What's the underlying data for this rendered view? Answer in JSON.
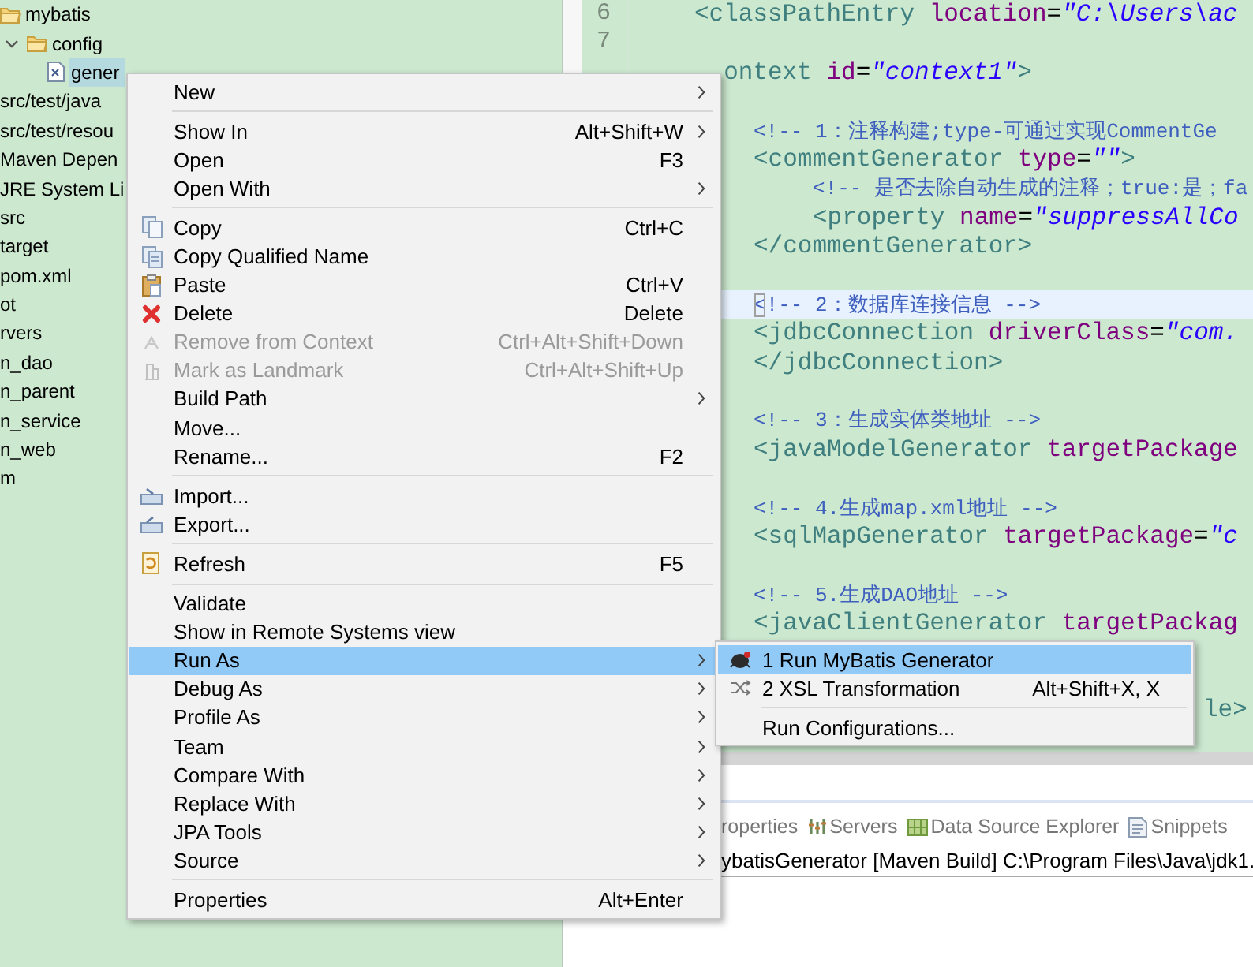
{
  "explorer": {
    "items": [
      {
        "label": "mybatis",
        "selected": false,
        "children": [
          {
            "label": "config",
            "selected": false,
            "expanded": true,
            "children": [
              {
                "label": "gener",
                "selected": true
              }
            ]
          }
        ]
      },
      {
        "label": "src/test/java",
        "selected": false
      },
      {
        "label": "src/test/resou",
        "selected": false
      },
      {
        "label": "Maven Depen",
        "selected": false
      },
      {
        "label": "JRE System Li",
        "selected": false
      },
      {
        "label": "src",
        "selected": false
      },
      {
        "label": "target",
        "selected": false
      },
      {
        "label": "pom.xml",
        "selected": false
      },
      {
        "label": "ot",
        "selected": false
      },
      {
        "label": "rvers",
        "selected": false
      },
      {
        "label": "n_dao",
        "selected": false
      },
      {
        "label": "n_parent",
        "selected": false
      },
      {
        "label": "n_service",
        "selected": false
      },
      {
        "label": "n_web",
        "selected": false
      },
      {
        "label": "m",
        "selected": false
      }
    ]
  },
  "editor": {
    "line_numbers": [
      "6",
      "7"
    ],
    "lines": [
      {
        "kind": "code",
        "segments": [
          {
            "kind": "tag",
            "text": "<classPathEntry"
          },
          {
            "kind": "attr",
            "text": "location"
          },
          {
            "kind": "plain",
            "text": "="
          },
          {
            "kind": "value",
            "text": "\"C:\\Users\\ac"
          }
        ]
      },
      {
        "kind": "blank"
      },
      {
        "kind": "clipped",
        "segments": [
          {
            "kind": "tag",
            "text": "ontext"
          },
          {
            "kind": "attr",
            "text": "id"
          },
          {
            "kind": "plain",
            "text": "="
          },
          {
            "kind": "value",
            "text": "\"context1\""
          },
          {
            "kind": "tag",
            "text": ">"
          }
        ],
        "children": [
          {
            "kind": "blank"
          },
          {
            "kind": "code",
            "segments": [
              {
                "kind": "comment",
                "text": "<!-- 1：注释构建;type-可通过实现CommentGe"
              }
            ]
          },
          {
            "kind": "code",
            "segments": [
              {
                "kind": "tag",
                "text": "<commentGenerator"
              },
              {
                "kind": "attr",
                "text": "type"
              },
              {
                "kind": "plain",
                "text": "="
              },
              {
                "kind": "value",
                "text": "\"\""
              },
              {
                "kind": "tag",
                "text": ">"
              }
            ],
            "children": [
              {
                "kind": "code",
                "segments": [
                  {
                    "kind": "comment",
                    "text": "<!-- 是否去除自动生成的注释；true:是；fa"
                  }
                ]
              },
              {
                "kind": "code",
                "segments": [
                  {
                    "kind": "tag",
                    "text": "<property"
                  },
                  {
                    "kind": "attr",
                    "text": "name"
                  },
                  {
                    "kind": "plain",
                    "text": "="
                  },
                  {
                    "kind": "value",
                    "text": "\"suppressAllCo"
                  }
                ]
              }
            ]
          },
          {
            "kind": "code",
            "segments": [
              {
                "kind": "tag",
                "text": "</commentGenerator>"
              }
            ]
          },
          {
            "kind": "blank"
          },
          {
            "kind": "code",
            "current": true,
            "segments": [
              {
                "kind": "comment",
                "text": "<!-- 2：数据库连接信息 -->"
              }
            ]
          },
          {
            "kind": "code",
            "segments": [
              {
                "kind": "tag",
                "text": "<jdbcConnection"
              },
              {
                "kind": "attr",
                "text": "driverClass"
              },
              {
                "kind": "plain",
                "text": "="
              },
              {
                "kind": "value",
                "text": "\"com."
              }
            ]
          },
          {
            "kind": "code",
            "segments": [
              {
                "kind": "tag",
                "text": "</jdbcConnection>"
              }
            ]
          },
          {
            "kind": "blank"
          },
          {
            "kind": "code",
            "segments": [
              {
                "kind": "comment",
                "text": "<!-- 3：生成实体类地址 -->"
              }
            ]
          },
          {
            "kind": "code",
            "segments": [
              {
                "kind": "tag",
                "text": "<javaModelGenerator"
              },
              {
                "kind": "attr",
                "text": "targetPackage"
              }
            ]
          },
          {
            "kind": "blank"
          },
          {
            "kind": "code",
            "segments": [
              {
                "kind": "comment",
                "text": "<!-- 4.生成map.xml地址 -->"
              }
            ]
          },
          {
            "kind": "code",
            "segments": [
              {
                "kind": "tag",
                "text": "<sqlMapGenerator"
              },
              {
                "kind": "attr",
                "text": "targetPackage"
              },
              {
                "kind": "plain",
                "text": "="
              },
              {
                "kind": "value",
                "text": "\"c"
              }
            ]
          },
          {
            "kind": "blank"
          },
          {
            "kind": "code",
            "segments": [
              {
                "kind": "comment",
                "text": "<!-- 5.生成DAO地址 -->"
              }
            ]
          },
          {
            "kind": "code",
            "segments": [
              {
                "kind": "tag",
                "text": "<javaClientGenerator"
              },
              {
                "kind": "attr",
                "text": "targetPackag"
              }
            ]
          },
          {
            "kind": "blank"
          },
          {
            "kind": "blank"
          },
          {
            "kind": "fragment",
            "segments": [
              {
                "kind": "tag",
                "text": "le>"
              }
            ]
          }
        ]
      }
    ]
  },
  "bottom_panel": {
    "tabs": [
      {
        "label": "roperties",
        "selected": false
      },
      {
        "label": "Servers",
        "selected": false
      },
      {
        "label": "Data Source Explorer",
        "selected": false
      },
      {
        "label": "Snippets",
        "selected": false
      }
    ],
    "console_title": "ybatisGenerator [Maven Build] C:\\Program Files\\Java\\jdk1."
  },
  "context_menu": {
    "groups": [
      [
        {
          "label": "New",
          "submenu": true,
          "disabled": false,
          "selected": false
        }
      ],
      [
        {
          "label": "Show In",
          "shortcut": "Alt+Shift+W",
          "submenu": true,
          "disabled": false,
          "selected": false
        },
        {
          "label": "Open",
          "shortcut": "F3",
          "submenu": false,
          "disabled": false,
          "selected": false
        },
        {
          "label": "Open With",
          "submenu": true,
          "disabled": false,
          "selected": false
        }
      ],
      [
        {
          "label": "Copy",
          "shortcut": "Ctrl+C",
          "submenu": false,
          "disabled": false,
          "selected": false
        },
        {
          "label": "Copy Qualified Name",
          "submenu": false,
          "disabled": false,
          "selected": false
        },
        {
          "label": "Paste",
          "shortcut": "Ctrl+V",
          "submenu": false,
          "disabled": false,
          "selected": false
        },
        {
          "label": "Delete",
          "shortcut": "Delete",
          "submenu": false,
          "disabled": false,
          "selected": false
        },
        {
          "label": "Remove from Context",
          "shortcut": "Ctrl+Alt+Shift+Down",
          "submenu": false,
          "disabled": true,
          "selected": false
        },
        {
          "label": "Mark as Landmark",
          "shortcut": "Ctrl+Alt+Shift+Up",
          "submenu": false,
          "disabled": true,
          "selected": false
        },
        {
          "label": "Build Path",
          "submenu": true,
          "disabled": false,
          "selected": false
        },
        {
          "label": "Move...",
          "submenu": false,
          "disabled": false,
          "selected": false
        },
        {
          "label": "Rename...",
          "shortcut": "F2",
          "submenu": false,
          "disabled": false,
          "selected": false
        }
      ],
      [
        {
          "label": "Import...",
          "submenu": false,
          "disabled": false,
          "selected": false
        },
        {
          "label": "Export...",
          "submenu": false,
          "disabled": false,
          "selected": false
        }
      ],
      [
        {
          "label": "Refresh",
          "shortcut": "F5",
          "submenu": false,
          "disabled": false,
          "selected": false
        }
      ],
      [
        {
          "label": "Validate",
          "submenu": false,
          "disabled": false,
          "selected": false
        },
        {
          "label": "Show in Remote Systems view",
          "submenu": false,
          "disabled": false,
          "selected": false
        },
        {
          "label": "Run As",
          "submenu": true,
          "disabled": false,
          "selected": true
        },
        {
          "label": "Debug As",
          "submenu": true,
          "disabled": false,
          "selected": false
        },
        {
          "label": "Profile As",
          "submenu": true,
          "disabled": false,
          "selected": false
        },
        {
          "label": "Team",
          "submenu": true,
          "disabled": false,
          "selected": false
        },
        {
          "label": "Compare With",
          "submenu": true,
          "disabled": false,
          "selected": false
        },
        {
          "label": "Replace With",
          "submenu": true,
          "disabled": false,
          "selected": false
        },
        {
          "label": "JPA Tools",
          "submenu": true,
          "disabled": false,
          "selected": false
        },
        {
          "label": "Source",
          "submenu": true,
          "disabled": false,
          "selected": false
        }
      ],
      [
        {
          "label": "Properties",
          "shortcut": "Alt+Enter",
          "submenu": false,
          "disabled": false,
          "selected": false
        }
      ]
    ]
  },
  "run_as_submenu": {
    "groups": [
      [
        {
          "label": "1 Run MyBatis Generator",
          "selected": true
        },
        {
          "label": "2 XSL Transformation",
          "shortcut": "Alt+Shift+X, X",
          "selected": false
        }
      ],
      [
        {
          "label": "Run Configurations...",
          "selected": false
        }
      ]
    ]
  }
}
